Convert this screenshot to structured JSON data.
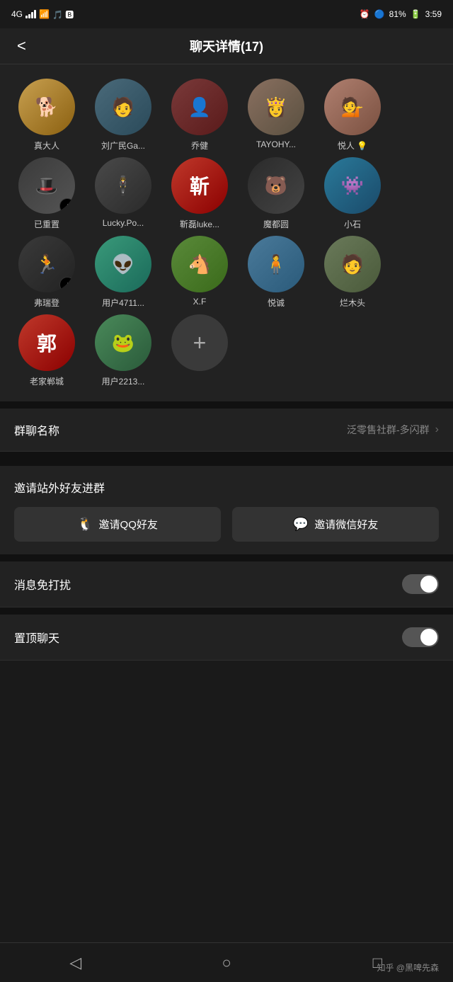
{
  "statusBar": {
    "signal": "4G",
    "wifi": "WiFi",
    "bluetooth": "BT",
    "battery": "81%",
    "time": "3:59"
  },
  "header": {
    "title": "聊天详情(17)",
    "backLabel": "<"
  },
  "members": [
    {
      "id": 1,
      "name": "真大人",
      "avatarClass": "av-dog",
      "avatarText": "🐕",
      "hasTiktok": false
    },
    {
      "id": 2,
      "name": "刘广民Ga...",
      "avatarClass": "av-person1",
      "avatarText": "👤",
      "hasTiktok": false
    },
    {
      "id": 3,
      "name": "乔健",
      "avatarClass": "av-person2",
      "avatarText": "👤",
      "hasTiktok": false
    },
    {
      "id": 4,
      "name": "TAYOHY...",
      "avatarClass": "av-lady1",
      "avatarText": "👰",
      "hasTiktok": false
    },
    {
      "id": 5,
      "name": "悦人 💡",
      "avatarClass": "av-lady2",
      "avatarText": "👩",
      "hasTiktok": false
    },
    {
      "id": 6,
      "name": "已重置",
      "avatarClass": "av-hat",
      "avatarText": "🎩",
      "hasTiktok": true
    },
    {
      "id": 7,
      "name": "Lucky.Po...",
      "avatarClass": "av-bw",
      "avatarText": "👔",
      "hasTiktok": false
    },
    {
      "id": 8,
      "name": "靳磊luke...",
      "avatarClass": "av-red",
      "avatarText": "靳",
      "hasTiktok": false
    },
    {
      "id": 9,
      "name": "魔都圆",
      "avatarClass": "av-bear",
      "avatarText": "🐻",
      "hasTiktok": false
    },
    {
      "id": 10,
      "name": "小石",
      "avatarClass": "av-blue",
      "avatarText": "👾",
      "hasTiktok": false
    },
    {
      "id": 11,
      "name": "弗瑞登",
      "avatarClass": "av-runner",
      "avatarText": "🏃",
      "hasTiktok": true
    },
    {
      "id": 12,
      "name": "用户4711...",
      "avatarClass": "av-teal",
      "avatarText": "👽",
      "hasTiktok": false
    },
    {
      "id": 13,
      "name": "X.F",
      "avatarClass": "av-horse",
      "avatarText": "🐴",
      "hasTiktok": false
    },
    {
      "id": 14,
      "name": "悦诚",
      "avatarClass": "av-outdoor",
      "avatarText": "🧍",
      "hasTiktok": false
    },
    {
      "id": 15,
      "name": "烂木头",
      "avatarClass": "av-outdoor2",
      "avatarText": "🧑",
      "hasTiktok": false
    },
    {
      "id": 16,
      "name": "老家郸城",
      "avatarClass": "av-郭",
      "avatarText": "郭",
      "hasTiktok": false
    },
    {
      "id": 17,
      "name": "用户2213...",
      "avatarClass": "av-frog",
      "avatarText": "🐸",
      "hasTiktok": false
    }
  ],
  "addButton": {
    "label": "+"
  },
  "settings": {
    "groupName": {
      "label": "群聊名称",
      "value": "泛零售社群-多闪群"
    },
    "inviteSection": {
      "label": "邀请站外好友进群",
      "qqButton": "邀请QQ好友",
      "wechatButton": "邀请微信好友"
    },
    "doNotDisturb": {
      "label": "消息免打扰",
      "enabled": false
    },
    "pinChat": {
      "label": "置顶聊天",
      "enabled": false
    }
  },
  "bottomNav": {
    "back": "◁",
    "home": "○",
    "recent": "□"
  },
  "watermark": "知乎 @黑啤先森"
}
